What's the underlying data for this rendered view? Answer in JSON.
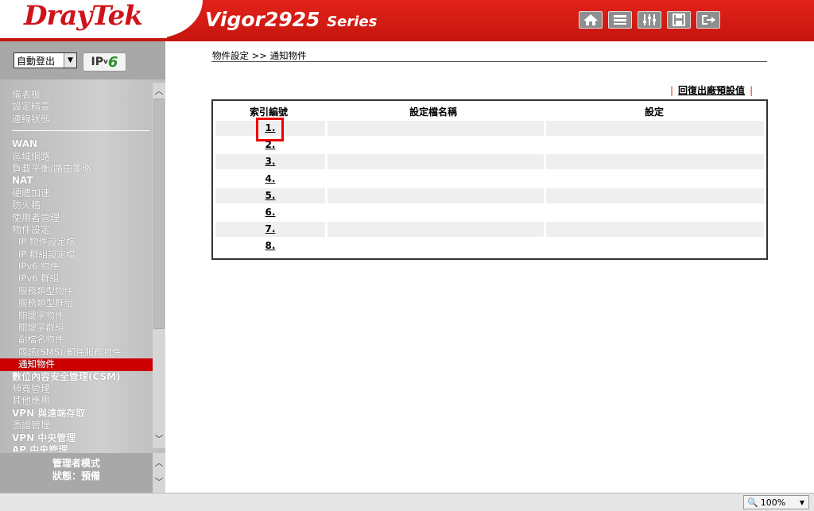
{
  "header": {
    "logo": "DrayTek",
    "product": "Vigor2925",
    "series": "Series",
    "icons": [
      "home-icon",
      "quick-start-icon",
      "settings-sliders-icon",
      "save-icon",
      "logout-icon"
    ]
  },
  "sidebar": {
    "logout_select": "自動登出",
    "ipv6_prefix": "IP",
    "ipv6_v": "v",
    "ipv6_six": "6",
    "menu": [
      {
        "label": "儀表板",
        "type": "item"
      },
      {
        "label": "設定精靈",
        "type": "item"
      },
      {
        "label": "連線狀態",
        "type": "item"
      },
      {
        "label": "WAN",
        "type": "bold"
      },
      {
        "label": "區域網路",
        "type": "item"
      },
      {
        "label": "負載平衡/路由策略",
        "type": "item"
      },
      {
        "label": "NAT",
        "type": "bold"
      },
      {
        "label": "硬體加速",
        "type": "item"
      },
      {
        "label": "防火牆",
        "type": "item"
      },
      {
        "label": "使用者管理",
        "type": "item"
      },
      {
        "label": "物件設定",
        "type": "item"
      },
      {
        "label": "IP 物件設定檔",
        "type": "sub"
      },
      {
        "label": "IP 群組設定檔",
        "type": "sub"
      },
      {
        "label": "IPv6 物件",
        "type": "sub"
      },
      {
        "label": "IPv6 群組",
        "type": "sub"
      },
      {
        "label": "服務類型物件",
        "type": "sub"
      },
      {
        "label": "服務類型群組",
        "type": "sub"
      },
      {
        "label": "關鍵字物件",
        "type": "sub"
      },
      {
        "label": "關鍵字群組",
        "type": "sub"
      },
      {
        "label": "副檔名物件",
        "type": "sub"
      },
      {
        "label": "簡訊(SMS)/郵件服務物件",
        "type": "sub"
      },
      {
        "label": "通知物件",
        "type": "sub-active"
      },
      {
        "label": "數位內容安全管理(CSM)",
        "type": "bold"
      },
      {
        "label": "頻寬管理",
        "type": "item"
      },
      {
        "label": "其他應用",
        "type": "item"
      },
      {
        "label": "VPN 與遠端存取",
        "type": "bold"
      },
      {
        "label": "憑證管理",
        "type": "item"
      },
      {
        "label": "VPN 中央管理",
        "type": "bold"
      },
      {
        "label": "AP 中央管理",
        "type": "bold"
      }
    ],
    "status_line1": "管理者模式",
    "status_line2": "狀態：預備"
  },
  "main": {
    "breadcrumb": "物件設定 >> 通知物件",
    "restore_label": "回復出廠預設值",
    "columns": [
      "索引編號",
      "設定檔名稱",
      "設定"
    ],
    "rows": [
      {
        "index": "1.",
        "name": "",
        "setting": ""
      },
      {
        "index": "2.",
        "name": "",
        "setting": ""
      },
      {
        "index": "3.",
        "name": "",
        "setting": ""
      },
      {
        "index": "4.",
        "name": "",
        "setting": ""
      },
      {
        "index": "5.",
        "name": "",
        "setting": ""
      },
      {
        "index": "6.",
        "name": "",
        "setting": ""
      },
      {
        "index": "7.",
        "name": "",
        "setting": ""
      },
      {
        "index": "8.",
        "name": "",
        "setting": ""
      }
    ]
  },
  "statusbar": {
    "zoom": "100%"
  }
}
